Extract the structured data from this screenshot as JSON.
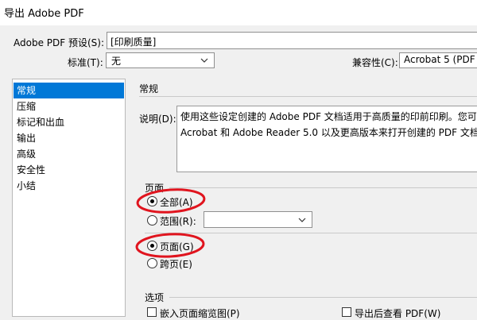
{
  "window": {
    "title": "导出 Adobe PDF"
  },
  "preset": {
    "label": "Adobe PDF 预设(S):",
    "value": "[印刷质量]"
  },
  "standard": {
    "label": "标准(T):",
    "value": "无"
  },
  "compat": {
    "label": "兼容性(C):",
    "value": "Acrobat 5 (PDF"
  },
  "sidebar": {
    "items": [
      {
        "label": "常规"
      },
      {
        "label": "压缩"
      },
      {
        "label": "标记和出血"
      },
      {
        "label": "输出"
      },
      {
        "label": "高级"
      },
      {
        "label": "安全性"
      },
      {
        "label": "小结"
      }
    ]
  },
  "general": {
    "heading": "常规",
    "description_label": "说明(D):",
    "description_lines": [
      "使用这些设定创建的 Adobe PDF 文档适用于高质量的印前印刷。您可",
      "Acrobat 和 Adobe Reader 5.0 以及更高版本来打开创建的 PDF 文档"
    ]
  },
  "pages": {
    "heading": "页面",
    "all_label": "全部(A)",
    "range_label": "范围(R):",
    "range_value": "",
    "pages_option_label": "页面(G)",
    "spreads_label": "跨页(E)"
  },
  "options": {
    "heading": "选项",
    "embed_thumbnails_label": "嵌入页面缩览图(P)",
    "view_after_export_label": "导出后查看 PDF(W)"
  },
  "annotation_color": "#e0141e",
  "accent_color": "#0078d7"
}
